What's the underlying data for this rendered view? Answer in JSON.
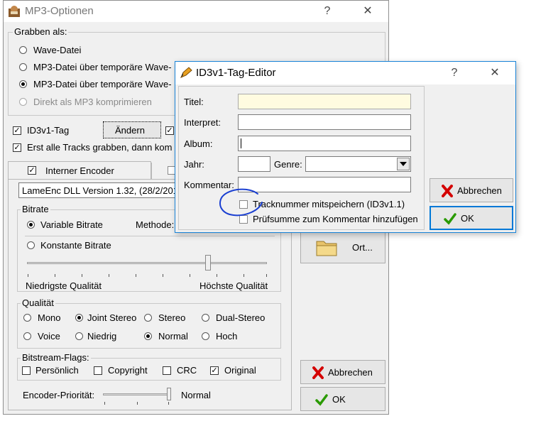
{
  "main": {
    "title": "MP3-Optionen",
    "help": "?",
    "close": "✕",
    "grab_group": {
      "label": "Grabben als:",
      "options": [
        "Wave-Datei",
        "MP3-Datei über temporäre Wave-",
        "MP3-Datei über temporäre Wave-",
        "Direkt als MP3 komprimieren"
      ],
      "selected_index": 2
    },
    "id3_check": "ID3v1-Tag",
    "change_button": "Ändern",
    "grab_first_check": "Erst alle Tracks grabben, dann kom",
    "tab_internal": "Interner Encoder",
    "encoder_value": "LameEnc DLL Version 1.32, (28/2/201",
    "bitrate": {
      "label": "Bitrate",
      "variable": "Variable Bitrate",
      "method": "Methode:",
      "constant": "Konstante Bitrate",
      "slider_fraction": 0.76,
      "low": "Niedrigste Qualität",
      "high": "Höchste Qualität"
    },
    "quality": {
      "label": "Qualität",
      "options": [
        "Mono",
        "Joint Stereo",
        "Stereo",
        "Dual-Stereo",
        "Voice",
        "Niedrig",
        "Normal",
        "Hoch"
      ],
      "selected_mode": "Joint Stereo",
      "selected_level": "Normal"
    },
    "flags": {
      "label": "Bitstream-Flags:",
      "items": [
        "Persönlich",
        "Copyright",
        "CRC",
        "Original"
      ],
      "checked": "Original"
    },
    "priority": {
      "label": "Encoder-Priorität:",
      "value": "Normal",
      "slider_fraction": 1.0
    },
    "browse_button": "Ort...",
    "cancel_button": "Abbrechen",
    "ok_button": "OK"
  },
  "dialog": {
    "title": "ID3v1-Tag-Editor",
    "help": "?",
    "close": "✕",
    "fields": {
      "title_label": "Titel:",
      "artist_label": "Interpret:",
      "album_label": "Album:",
      "year_label": "Jahr:",
      "genre_label": "Genre:",
      "comment_label": "Kommentar:"
    },
    "values": {
      "title": "",
      "artist": "",
      "album": "",
      "year": "",
      "genre": "",
      "comment": ""
    },
    "track_check": "Tracknummer mitspeichern (ID3v1.1)",
    "checksum_check": "Prüfsumme zum Kommentar hinzufügen",
    "cancel_button": "Abbrechen",
    "ok_button": "OK"
  },
  "colors": {
    "annotation": "#1a3fd1",
    "title_field_bg": "#fffbe0",
    "focus": "#0078d7",
    "red_x": "#d40000",
    "green_check": "#2a9a00"
  }
}
